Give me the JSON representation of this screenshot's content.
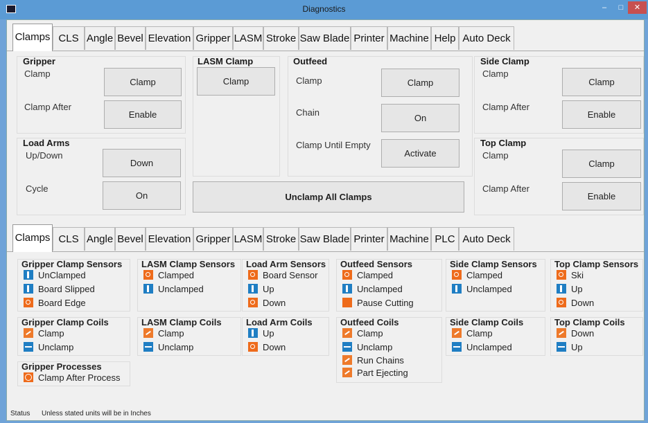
{
  "window": {
    "title": "Diagnostics"
  },
  "top_tabs": [
    "Clamps",
    "CLS",
    "Angle",
    "Bevel",
    "Elevation",
    "Gripper",
    "LASM",
    "Stroke",
    "Saw Blade",
    "Printer",
    "Machine",
    "Help",
    "Auto Deck"
  ],
  "bottom_tabs": [
    "Clamps",
    "CLS",
    "Angle",
    "Bevel",
    "Elevation",
    "Gripper",
    "LASM",
    "Stroke",
    "Saw Blade",
    "Printer",
    "Machine",
    "PLC",
    "Auto Deck"
  ],
  "gripper": {
    "title": "Gripper",
    "clamp_label": "Clamp",
    "clamp_btn": "Clamp",
    "clamp_after_label": "Clamp After",
    "clamp_after_btn": "Enable"
  },
  "load_arms": {
    "title": "Load Arms",
    "updown_label": "Up/Down",
    "updown_btn": "Down",
    "cycle_label": "Cycle",
    "cycle_btn": "On"
  },
  "lasm_clamp": {
    "title": "LASM Clamp",
    "clamp_btn": "Clamp"
  },
  "outfeed": {
    "title": "Outfeed",
    "clamp_label": "Clamp",
    "clamp_btn": "Clamp",
    "chain_label": "Chain",
    "chain_btn": "On",
    "until_empty_label": "Clamp Until Empty",
    "until_empty_btn": "Activate"
  },
  "unclamp_all": "Unclamp All Clamps",
  "side_clamp": {
    "title": "Side Clamp",
    "clamp_label": "Clamp",
    "clamp_btn": "Clamp",
    "clamp_after_label": "Clamp After",
    "clamp_after_btn": "Enable"
  },
  "top_clamp": {
    "title": "Top Clamp",
    "clamp_label": "Clamp",
    "clamp_btn": "Clamp",
    "clamp_after_label": "Clamp After",
    "clamp_after_btn": "Enable"
  },
  "sensors": {
    "gripper_clamp_sensors": {
      "title": "Gripper Clamp Sensors",
      "items": [
        {
          "icon": "blue-bar-icon",
          "label": "UnClamped"
        },
        {
          "icon": "blue-bar-icon",
          "label": "Board Slipped"
        },
        {
          "icon": "orange-circle-icon",
          "label": "Board Edge"
        }
      ]
    },
    "lasm_clamp_sensors": {
      "title": "LASM Clamp Sensors",
      "items": [
        {
          "icon": "orange-circle-icon",
          "label": "Clamped"
        },
        {
          "icon": "blue-bar-icon",
          "label": "Unclamped"
        }
      ]
    },
    "load_arm_sensors": {
      "title": "Load Arm Sensors",
      "items": [
        {
          "icon": "orange-circle-icon",
          "label": "Board Sensor"
        },
        {
          "icon": "blue-bar-icon",
          "label": "Up"
        },
        {
          "icon": "orange-circle-icon",
          "label": "Down"
        }
      ]
    },
    "outfeed_sensors": {
      "title": "Outfeed Sensors",
      "items": [
        {
          "icon": "orange-circle-icon",
          "label": "Clamped"
        },
        {
          "icon": "blue-bar-icon",
          "label": "Unclamped"
        },
        {
          "icon": "orange-square-icon",
          "label": "Pause Cutting"
        }
      ]
    },
    "side_clamp_sensors": {
      "title": "Side Clamp Sensors",
      "items": [
        {
          "icon": "orange-circle-icon",
          "label": "Clamped"
        },
        {
          "icon": "blue-bar-icon",
          "label": "Unclamped"
        }
      ]
    },
    "top_clamp_sensors": {
      "title": "Top Clamp Sensors",
      "items": [
        {
          "icon": "orange-circle-icon",
          "label": "Ski"
        },
        {
          "icon": "blue-bar-icon",
          "label": "Up"
        },
        {
          "icon": "orange-circle-icon",
          "label": "Down"
        }
      ]
    },
    "gripper_clamp_coils": {
      "title": "Gripper Clamp Coils",
      "items": [
        {
          "icon": "orange-coil-icon",
          "label": "Clamp"
        },
        {
          "icon": "blue-dash-icon",
          "label": "Unclamp"
        }
      ]
    },
    "lasm_clamp_coils": {
      "title": "LASM Clamp Coils",
      "items": [
        {
          "icon": "orange-coil-icon",
          "label": "Clamp"
        },
        {
          "icon": "blue-dash-icon",
          "label": "Unclamp"
        }
      ]
    },
    "load_arm_coils": {
      "title": "Load Arm Coils",
      "items": [
        {
          "icon": "blue-bar-icon",
          "label": "Up"
        },
        {
          "icon": "orange-circle-icon",
          "label": "Down"
        }
      ]
    },
    "outfeed_coils": {
      "title": "Outfeed Coils",
      "items": [
        {
          "icon": "orange-coil-icon",
          "label": "Clamp"
        },
        {
          "icon": "blue-dash-icon",
          "label": "Unclamp"
        },
        {
          "icon": "orange-coil-icon",
          "label": "Run Chains"
        },
        {
          "icon": "orange-coil-icon",
          "label": "Part Ejecting"
        }
      ]
    },
    "side_clamp_coils": {
      "title": "Side Clamp Coils",
      "items": [
        {
          "icon": "orange-coil-icon",
          "label": "Clamp"
        },
        {
          "icon": "blue-dash-icon",
          "label": "Unclamped"
        }
      ]
    },
    "top_clamp_coils": {
      "title": "Top Clamp Coils",
      "items": [
        {
          "icon": "orange-coil-icon",
          "label": "Down"
        },
        {
          "icon": "blue-dash-icon",
          "label": "Up"
        }
      ]
    },
    "gripper_processes": {
      "title": "Gripper Processes",
      "items": [
        {
          "icon": "orange-process-icon",
          "label": "Clamp After Process"
        }
      ]
    }
  },
  "status": {
    "label": "Status",
    "text": "Unless stated units will be in Inches"
  },
  "colors": {
    "accent_blue": "#1f7ec3",
    "accent_orange": "#ee6b1b",
    "titlebar": "#5b9bd5",
    "close": "#c75050"
  }
}
